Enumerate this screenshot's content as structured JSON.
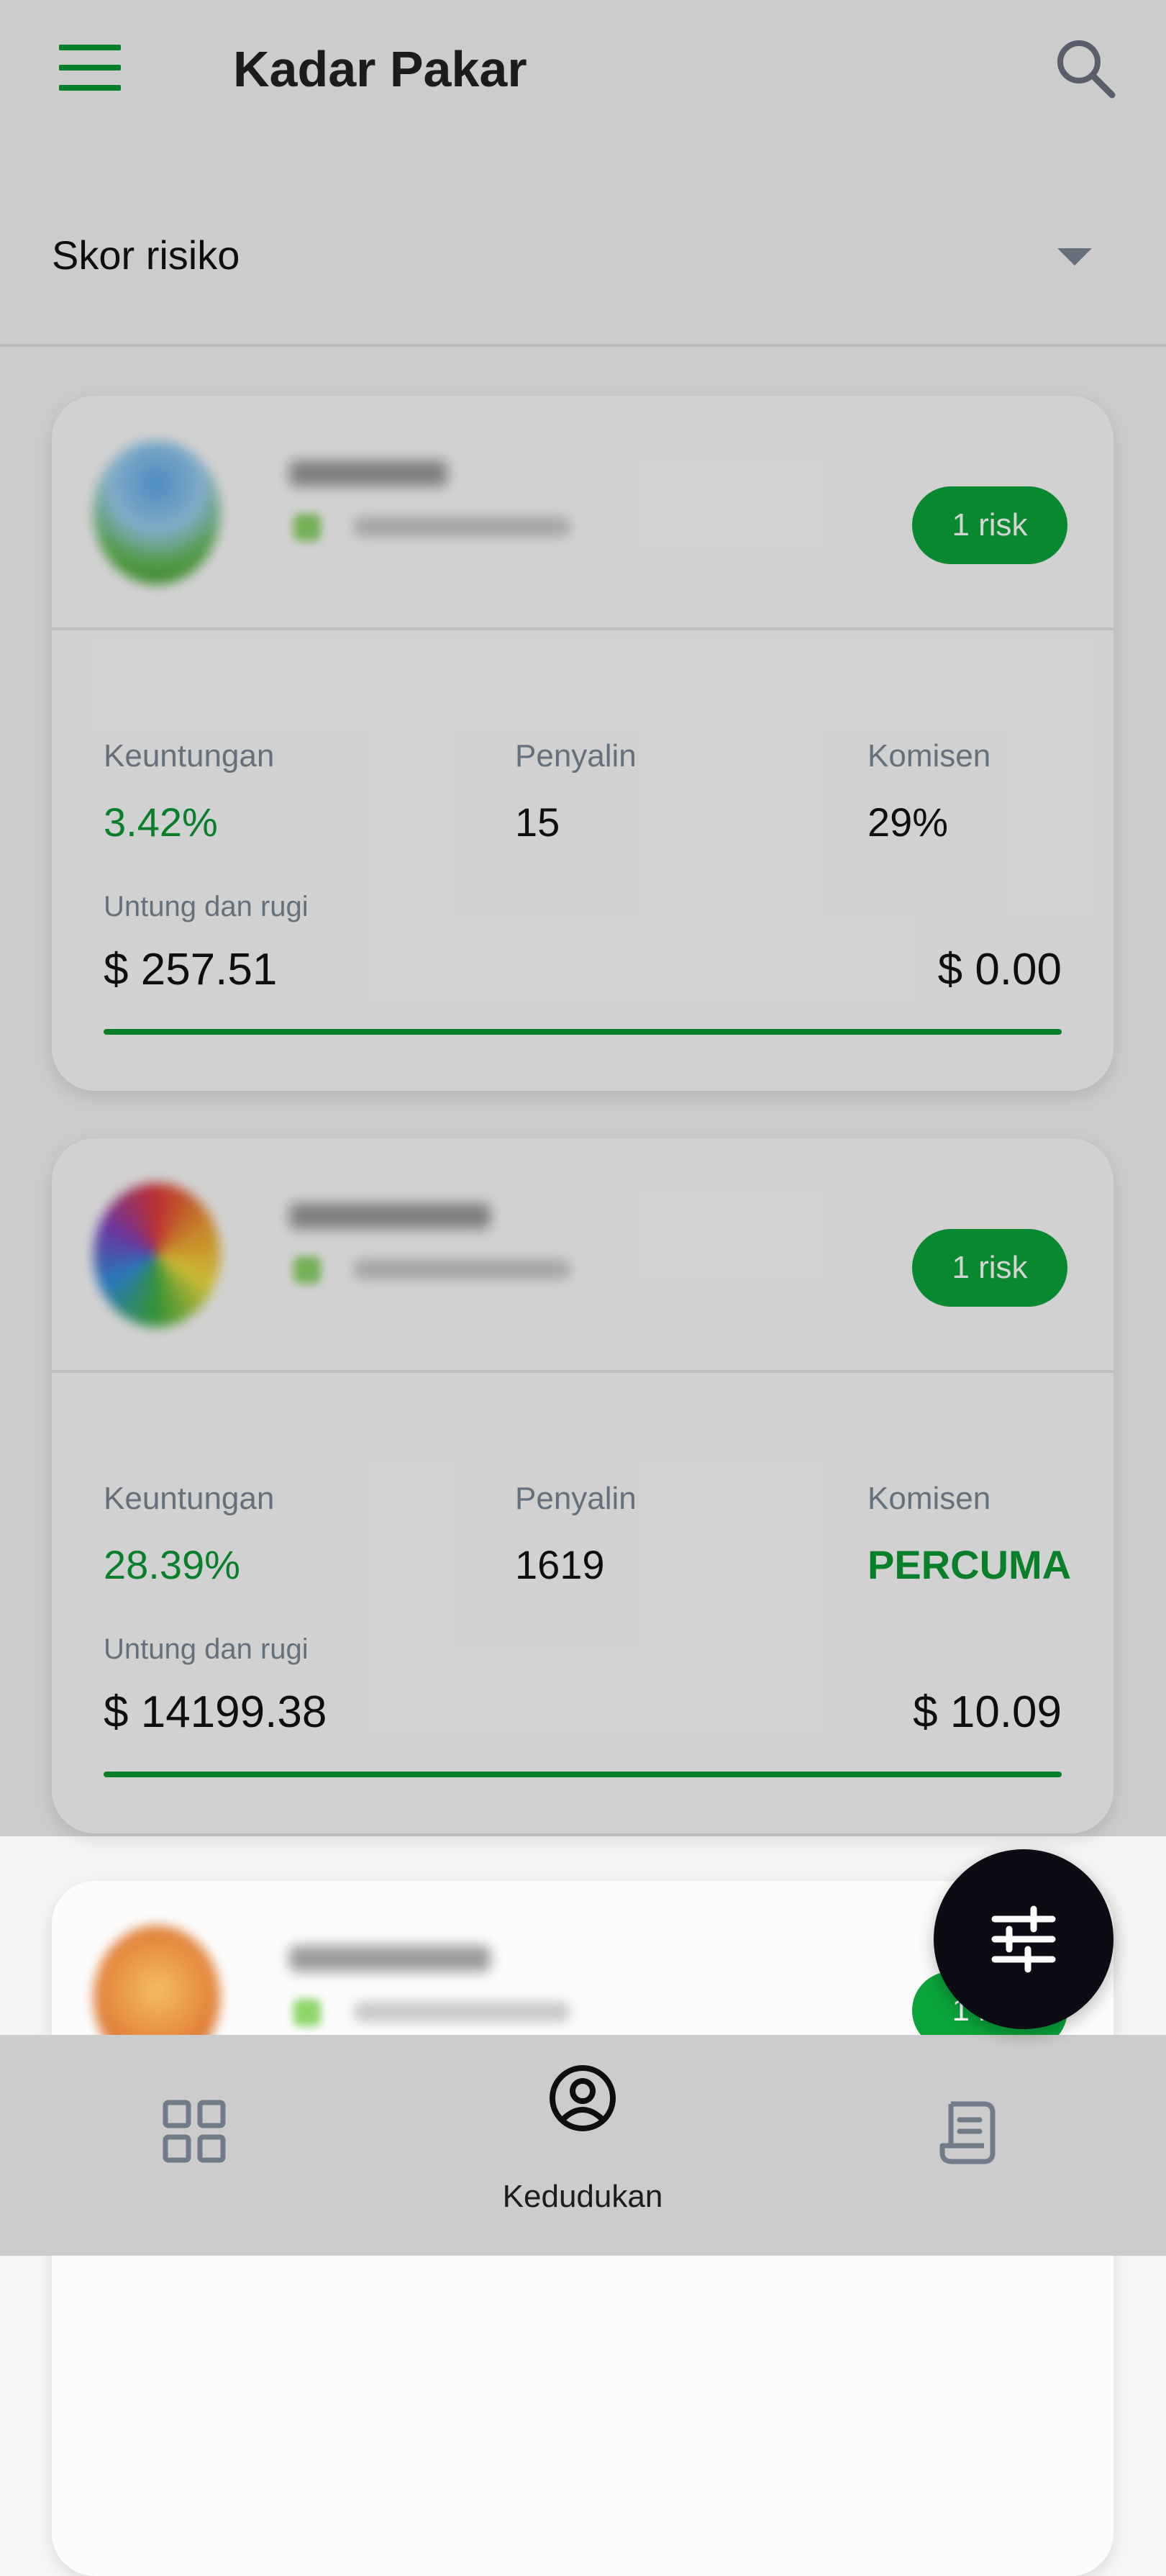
{
  "header": {
    "title": "Kadar Pakar"
  },
  "filter": {
    "selected": "Skor risiko"
  },
  "cards": [
    {
      "risk_badge": "1 risk",
      "profit_label": "Keuntungan",
      "profit_value": "3.42%",
      "copiers_label": "Penyalin",
      "copiers_value": "15",
      "commission_label": "Komisen",
      "commission_value": "29%",
      "pnl_label": "Untung dan rugi",
      "pnl_left": "$ 257.51",
      "pnl_right": "$ 0.00"
    },
    {
      "risk_badge": "1 risk",
      "profit_label": "Keuntungan",
      "profit_value": "28.39%",
      "copiers_label": "Penyalin",
      "copiers_value": "1619",
      "commission_label": "Komisen",
      "commission_value": "PERCUMA",
      "pnl_label": "Untung dan rugi",
      "pnl_left": "$ 14199.38",
      "pnl_right": "$ 10.09"
    },
    {
      "risk_badge": "1 risk"
    }
  ],
  "bottom_nav": {
    "items": [
      {
        "icon": "grid-icon",
        "label": ""
      },
      {
        "icon": "user-circle-icon",
        "label": "Kedudukan"
      },
      {
        "icon": "receipt-icon",
        "label": ""
      }
    ]
  },
  "colors": {
    "accent": "#0a9a33",
    "badge": "#0aa53a",
    "fab": "#0c0c14"
  }
}
